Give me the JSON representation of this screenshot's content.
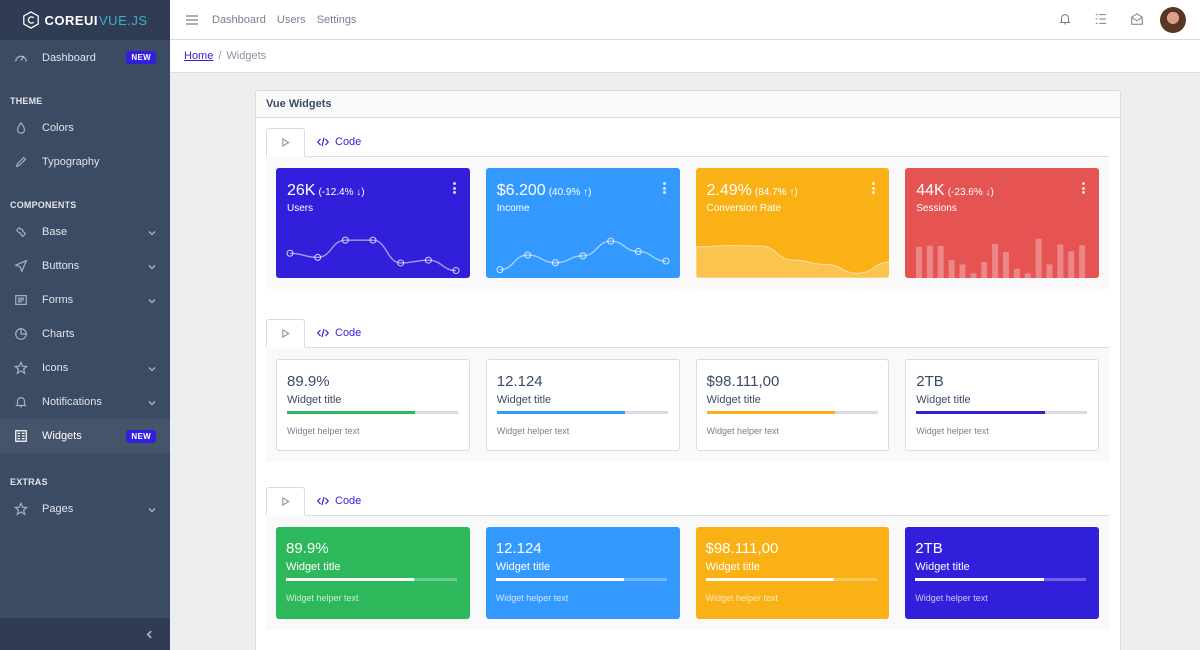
{
  "brand": {
    "name": "COREUI",
    "suffix": "VUE.JS"
  },
  "sidebar": {
    "dashboard": {
      "label": "Dashboard",
      "badge": "NEW"
    },
    "sections": [
      {
        "title": "THEME",
        "items": [
          {
            "label": "Colors",
            "icon": "drop-icon"
          },
          {
            "label": "Typography",
            "icon": "pencil-icon"
          }
        ]
      },
      {
        "title": "COMPONENTS",
        "items": [
          {
            "label": "Base",
            "icon": "puzzle-icon"
          },
          {
            "label": "Buttons",
            "icon": "cursor-icon"
          },
          {
            "label": "Forms",
            "icon": "notes-icon"
          },
          {
            "label": "Charts",
            "icon": "chart-pie-icon"
          },
          {
            "label": "Icons",
            "icon": "star-icon"
          },
          {
            "label": "Notifications",
            "icon": "bell-icon"
          },
          {
            "label": "Widgets",
            "icon": "calculator-icon",
            "badge": "NEW"
          }
        ]
      },
      {
        "title": "EXTRAS",
        "items": [
          {
            "label": "Pages",
            "icon": "star-icon"
          }
        ]
      }
    ]
  },
  "header": {
    "nav": [
      "Dashboard",
      "Users",
      "Settings"
    ]
  },
  "breadcrumb": {
    "home": "Home",
    "current": "Widgets"
  },
  "card": {
    "title": "Vue Widgets",
    "code_tab": "Code"
  },
  "chart_widgets": [
    {
      "value": "26K",
      "change": "(-12.4% ↓)",
      "title": "Users",
      "color": "#321fdb"
    },
    {
      "value": "$6.200",
      "change": "(40.9% ↑)",
      "title": "Income",
      "color": "#39f"
    },
    {
      "value": "2.49%",
      "change": "(84.7% ↑)",
      "title": "Conversion Rate",
      "color": "#f9b115"
    },
    {
      "value": "44K",
      "change": "(-23.6% ↓)",
      "title": "Sessions",
      "color": "#e55353"
    }
  ],
  "chart_data": [
    {
      "type": "line",
      "name": "Users",
      "values": [
        65,
        59,
        84,
        84,
        51,
        55,
        40
      ]
    },
    {
      "type": "line",
      "name": "Income",
      "values": [
        1,
        18,
        9,
        17,
        34,
        22,
        11
      ]
    },
    {
      "type": "area",
      "name": "Conversion Rate",
      "values": [
        78,
        81,
        80,
        45,
        34,
        12,
        40
      ]
    },
    {
      "type": "bar",
      "name": "Sessions",
      "values": [
        78,
        81,
        80,
        45,
        34,
        12,
        40,
        85,
        65,
        23,
        12,
        98,
        34,
        84,
        67,
        82
      ]
    }
  ],
  "progress_white": [
    {
      "value": "89.9%",
      "title": "Widget title",
      "helper": "Widget helper text",
      "color": "#2eb85c",
      "progress": 75
    },
    {
      "value": "12.124",
      "title": "Widget title",
      "helper": "Widget helper text",
      "color": "#39f",
      "progress": 75
    },
    {
      "value": "$98.111,00",
      "title": "Widget title",
      "helper": "Widget helper text",
      "color": "#f9b115",
      "progress": 75
    },
    {
      "value": "2TB",
      "title": "Widget title",
      "helper": "Widget helper text",
      "color": "#321fdb",
      "progress": 75
    }
  ],
  "progress_colored": [
    {
      "value": "89.9%",
      "title": "Widget title",
      "helper": "Widget helper text",
      "color": "#2eb85c",
      "progress": 75
    },
    {
      "value": "12.124",
      "title": "Widget title",
      "helper": "Widget helper text",
      "color": "#39f",
      "progress": 75
    },
    {
      "value": "$98.111,00",
      "title": "Widget title",
      "helper": "Widget helper text",
      "color": "#f9b115",
      "progress": 75
    },
    {
      "value": "2TB",
      "title": "Widget title",
      "helper": "Widget helper text",
      "color": "#321fdb",
      "progress": 75
    }
  ]
}
